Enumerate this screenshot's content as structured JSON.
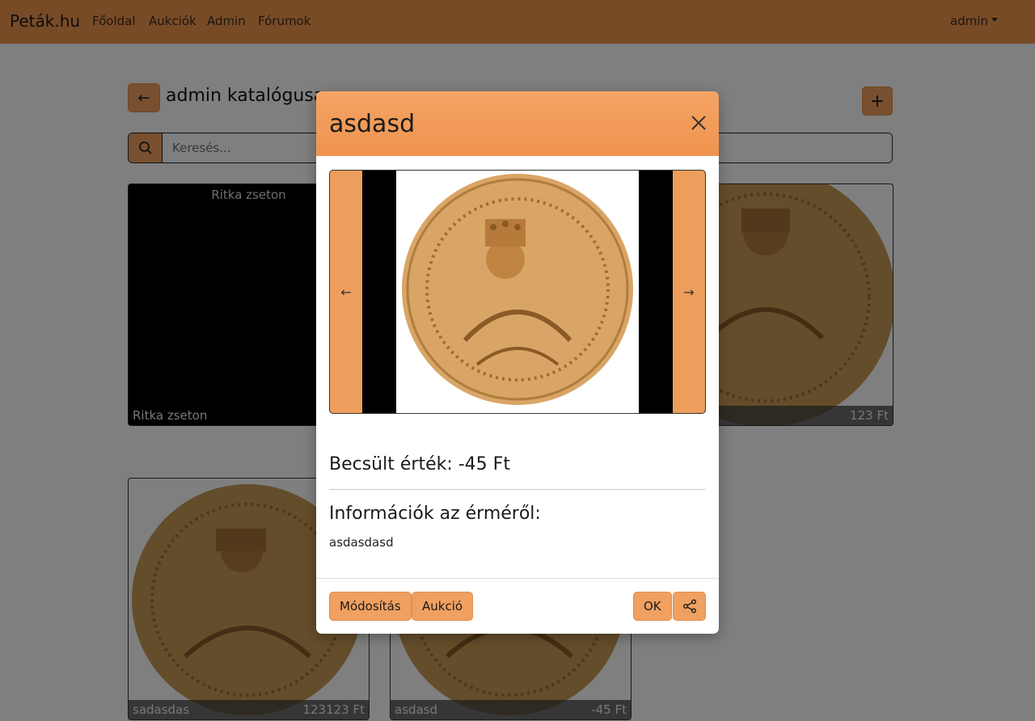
{
  "nav": {
    "brand": "Peták.hu",
    "links": [
      "Főoldal",
      "Aukciók",
      "Admin",
      "Fórumok"
    ],
    "user": "admin"
  },
  "page": {
    "title": "admin katalógusa",
    "search_placeholder": "Keresés...",
    "cards": [
      {
        "top_title": "Ritka zseton",
        "name": "Ritka zseton",
        "price": ""
      },
      {
        "name": "",
        "price": "123 Ft"
      },
      {
        "name": "sadasdas",
        "price": "123123 Ft"
      },
      {
        "name": "asdasd",
        "price": "-45 Ft"
      }
    ]
  },
  "modal": {
    "title": "asdasd",
    "value": "Becsült érték: -45 Ft",
    "info_heading": "Információk az érméről:",
    "info_text": "asdasdasd",
    "buttons": {
      "edit": "Módosítás",
      "auction": "Aukció",
      "ok": "OK"
    },
    "carousel": {
      "prev": "←",
      "next": "→"
    }
  },
  "colors": {
    "accent": "#f0964f",
    "button": "#f0a060"
  }
}
